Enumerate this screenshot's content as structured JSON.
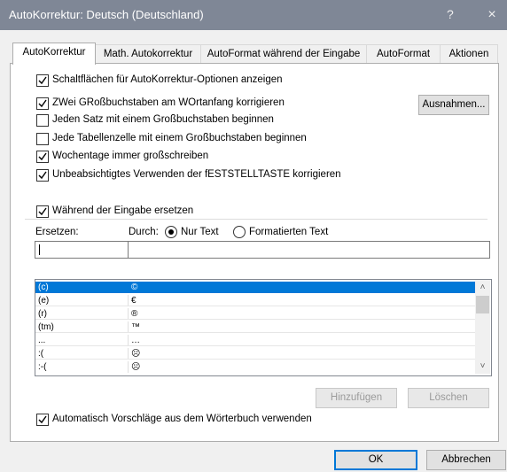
{
  "window": {
    "title": "AutoKorrektur: Deutsch (Deutschland)",
    "help": "?",
    "close": "×"
  },
  "tabs": [
    {
      "label": "AutoKorrektur"
    },
    {
      "label": "Math. Autokorrektur"
    },
    {
      "label": "AutoFormat während der Eingabe"
    },
    {
      "label": "AutoFormat"
    },
    {
      "label": "Aktionen"
    }
  ],
  "options": {
    "show_buttons": "Schaltflächen für AutoKorrektur-Optionen anzeigen",
    "two_caps": "ZWei GRoßbuchstaben am WOrtanfang korrigieren",
    "sentence_cap": "Jeden Satz mit einem Großbuchstaben beginnen",
    "table_cap": "Jede Tabellenzelle mit einem Großbuchstaben beginnen",
    "weekdays": "Wochentage immer großschreiben",
    "capslock": "Unbeabsichtigtes Verwenden der fESTSTELLTASTE korrigieren",
    "exceptions_button": "Ausnahmen..."
  },
  "replace": {
    "group_label": "Während der Eingabe ersetzen",
    "replace_label": "Ersetzen:",
    "with_label": "Durch:",
    "plain_text": "Nur Text",
    "formatted_text": "Formatierten Text",
    "replace_value": "",
    "with_value": ""
  },
  "entries": [
    {
      "from": "(c)",
      "to": "©"
    },
    {
      "from": "(e)",
      "to": "€"
    },
    {
      "from": "(r)",
      "to": "®"
    },
    {
      "from": "(tm)",
      "to": "™"
    },
    {
      "from": "...",
      "to": "…"
    },
    {
      "from": ":(",
      "to": "☹"
    },
    {
      "from": ":-(",
      "to": "☹"
    }
  ],
  "list_buttons": {
    "add": "Hinzufügen",
    "delete": "Löschen"
  },
  "dictionary_suggestions": "Automatisch Vorschläge aus dem Wörterbuch verwenden",
  "footer": {
    "ok": "OK",
    "cancel": "Abbrechen"
  }
}
